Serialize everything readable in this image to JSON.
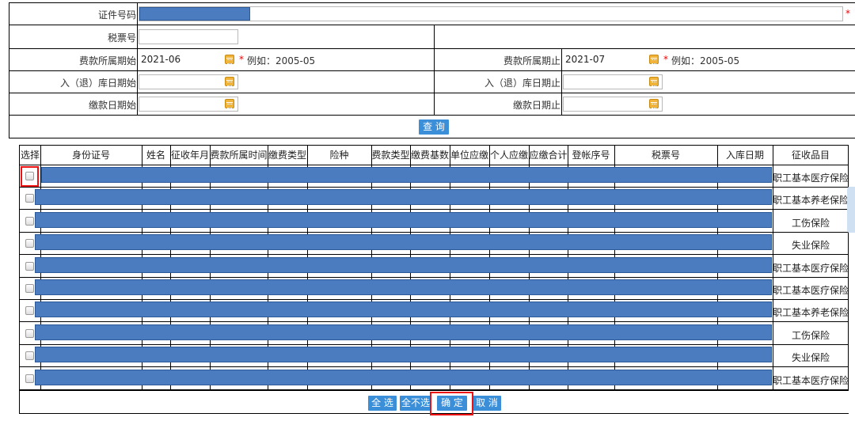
{
  "form": {
    "id_number_label": "证件号码",
    "tax_ticket_label": "税票号",
    "period_start_label": "费款所属期始",
    "period_start_value": "2021-06",
    "period_end_label": "费款所属期止",
    "period_end_value": "2021-07",
    "example_hint": "例如：2005-05",
    "required_mark": "*",
    "storage_start_label": "入（退）库日期始",
    "storage_end_label": "入（退）库日期止",
    "pay_start_label": "缴款日期始",
    "pay_end_label": "缴款日期止",
    "query_button": "查 询"
  },
  "table": {
    "columns": [
      "选择",
      "身份证号",
      "姓名",
      "征收年月",
      "费款所属时间",
      "缴费类型",
      "险种",
      "费款类型",
      "缴费基数",
      "单位应缴",
      "个人应缴",
      "应缴合计",
      "登帐序号",
      "税票号",
      "入库日期",
      "征收品目"
    ],
    "rows": [
      {
        "category": "职工基本医疗保险"
      },
      {
        "category": "职工基本养老保险"
      },
      {
        "category": "工伤保险"
      },
      {
        "category": "失业保险"
      },
      {
        "category": "职工基本医疗保险"
      },
      {
        "category": "职工基本医疗保险"
      },
      {
        "category": "职工基本养老保险"
      },
      {
        "category": "工伤保险"
      },
      {
        "category": "失业保险"
      },
      {
        "category": "职工基本医疗保险"
      }
    ]
  },
  "footer": {
    "select_all": "全 选",
    "select_none": "全不选",
    "confirm": "确 定",
    "cancel": "取 消"
  },
  "colors": {
    "button_blue": "#3b8ed8",
    "redaction_blue": "#4b7cbf",
    "highlight_red": "#e11111",
    "calendar_icon": "#f0b43a"
  }
}
